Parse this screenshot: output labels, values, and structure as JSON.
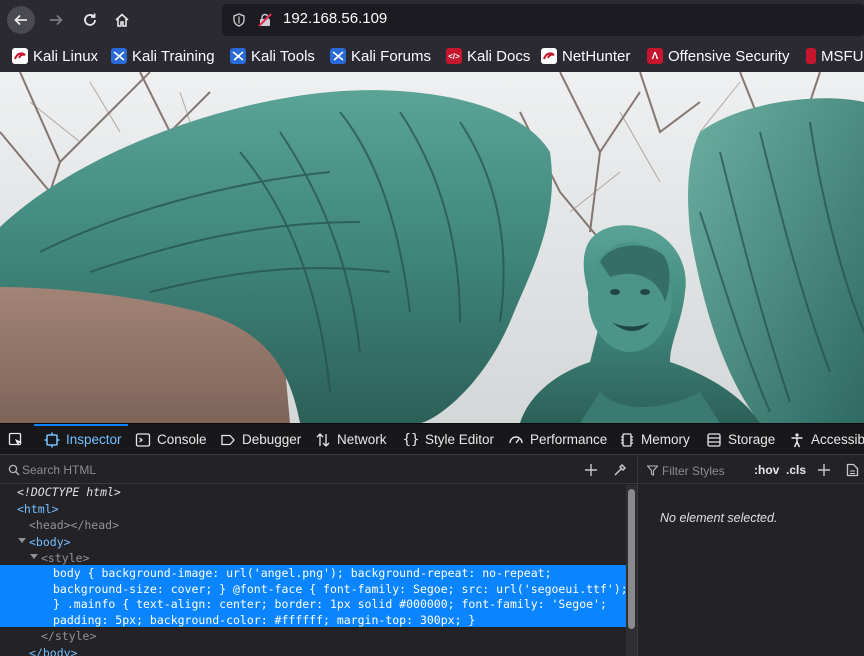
{
  "url": "192.168.56.109",
  "bookmarks": [
    {
      "label": "Kali Linux"
    },
    {
      "label": "Kali Training"
    },
    {
      "label": "Kali Tools"
    },
    {
      "label": "Kali Forums"
    },
    {
      "label": "Kali Docs"
    },
    {
      "label": "NetHunter"
    },
    {
      "label": "Offensive Security"
    },
    {
      "label": "MSFU"
    }
  ],
  "devtools": {
    "tabs": [
      {
        "label": "Inspector",
        "icon": "inspector-icon"
      },
      {
        "label": "Console",
        "icon": "console-icon"
      },
      {
        "label": "Debugger",
        "icon": "debugger-icon"
      },
      {
        "label": "Network",
        "icon": "network-icon"
      },
      {
        "label": "Style Editor",
        "icon": "style-editor-icon"
      },
      {
        "label": "Performance",
        "icon": "performance-icon"
      },
      {
        "label": "Memory",
        "icon": "memory-icon"
      },
      {
        "label": "Storage",
        "icon": "storage-icon"
      },
      {
        "label": "Accessibi",
        "icon": "accessibility-icon"
      }
    ],
    "selected_tab": "Inspector",
    "search_placeholder": "Search HTML",
    "filter_placeholder": "Filter Styles",
    "hov_label": ":hov",
    "cls_label": ".cls",
    "no_selection": "No element selected.",
    "markup": {
      "doctype": "<!DOCTYPE html>",
      "html_open": "<html>",
      "head": "<head></head>",
      "body_open": "<body>",
      "style_open": "<style>",
      "style_lines": [
        "body { background-image: url('angel.png'); background-repeat: no-repeat;",
        "background-size: cover; } @font-face { font-family: Segoe; src: url('segoeui.ttf');",
        "} .mainfo { text-align: center; border: 1px solid #000000; font-family: 'Segoe';",
        "padding: 5px; background-color: #ffffff; margin-top: 300px; }"
      ],
      "style_close": "</style>",
      "body_close": "</body>"
    }
  },
  "colors": {
    "chrome_bg": "#2b2a33",
    "devtools_bg": "#232327",
    "accent": "#0a84ff",
    "selected_tab_text": "#75bfff"
  }
}
